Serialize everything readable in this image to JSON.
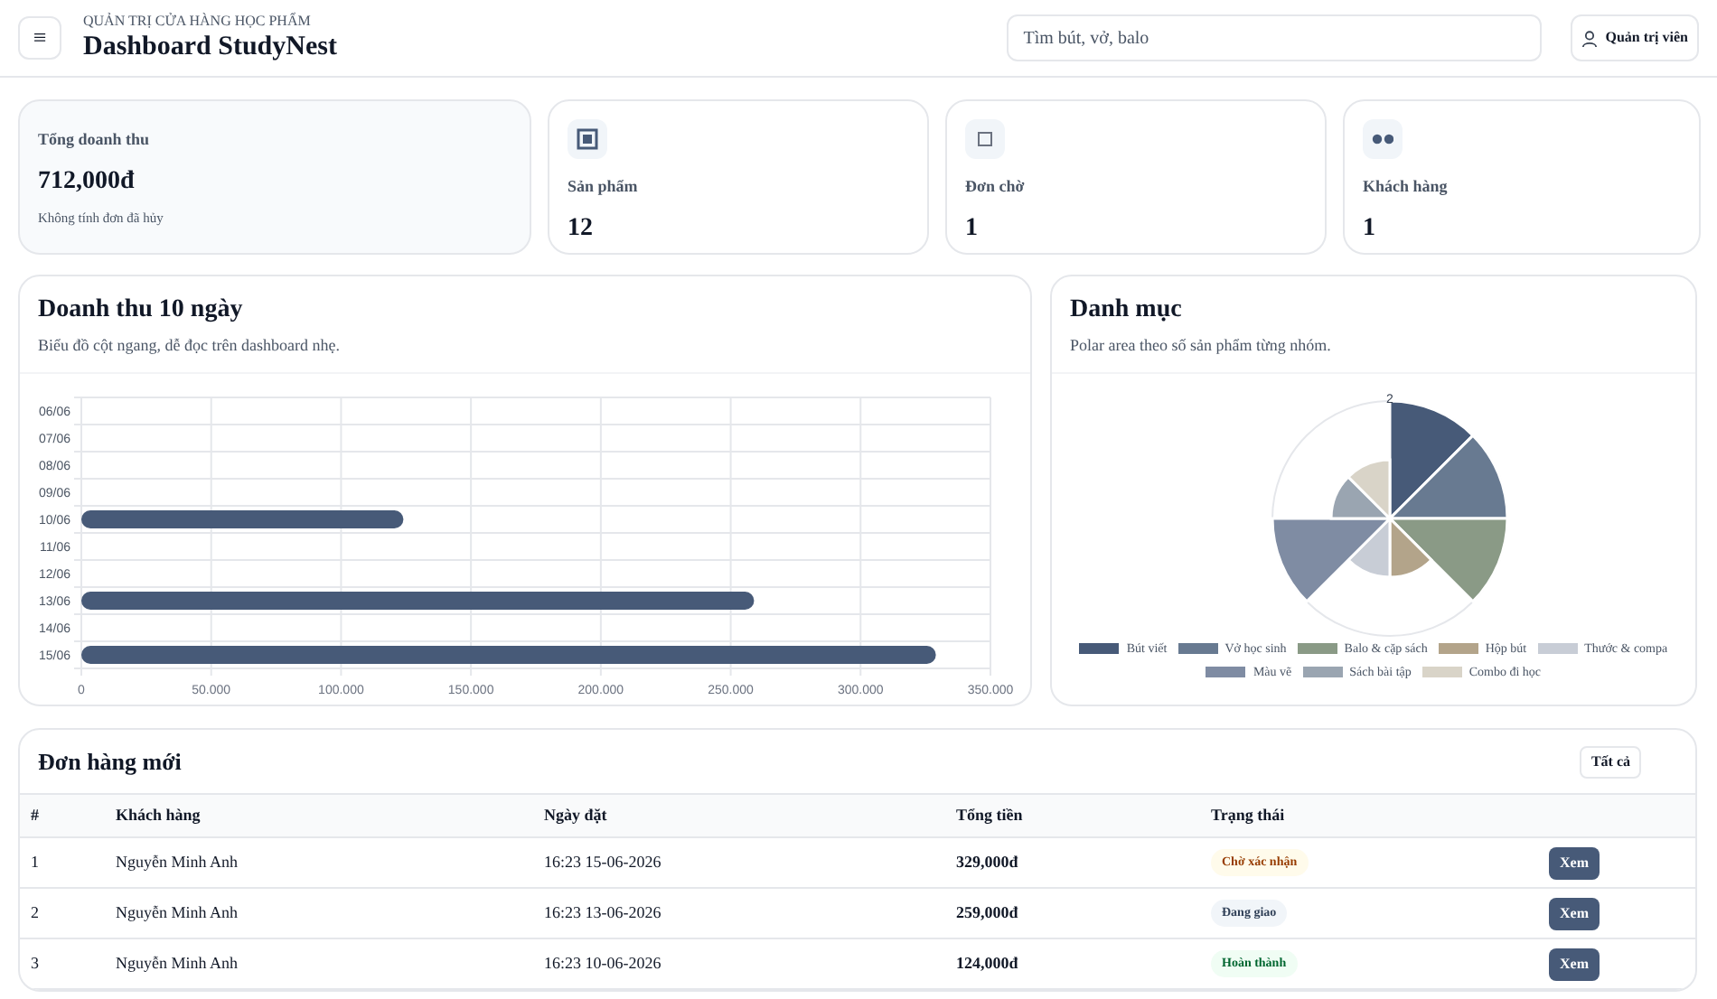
{
  "header": {
    "menu_icon": "≡",
    "subtitle": "QUẢN TRỊ CỬA HÀNG HỌC PHẨM",
    "title": "Dashboard StudyNest",
    "search": {
      "placeholder": "Tìm bút, vở, balo"
    },
    "user_button": "Quản trị viên"
  },
  "stats": [
    {
      "kind": "highlight",
      "label": "Tổng doanh thu",
      "value": "712,000đ",
      "note": "Không tính đơn đã hủy"
    },
    {
      "kind": "box",
      "label": "Sản phẩm",
      "value": "12"
    },
    {
      "kind": "box",
      "label": "Đơn chờ",
      "value": "1"
    },
    {
      "kind": "box",
      "label": "Khách hàng",
      "value": "1"
    }
  ],
  "revenue": {
    "title": "Doanh thu 10 ngày",
    "subtitle": "Biểu đồ cột ngang, dễ đọc trên dashboard nhẹ.",
    "chart_data": {
      "type": "bar",
      "orientation": "horizontal",
      "grid": true,
      "categories": [
        "06/06",
        "07/06",
        "08/06",
        "09/06",
        "10/06",
        "11/06",
        "12/06",
        "13/06",
        "14/06",
        "15/06"
      ],
      "series": [
        {
          "color": "#475a78",
          "values": [
            0,
            0,
            0,
            0,
            124000,
            0,
            0,
            259000,
            0,
            329000
          ]
        }
      ],
      "xlim": [
        0,
        350000
      ],
      "xticks": [
        {
          "value": 0,
          "label": "0"
        },
        {
          "value": 50000,
          "label": "50.000"
        },
        {
          "value": 100000,
          "label": "100.000"
        },
        {
          "value": 150000,
          "label": "150.000"
        },
        {
          "value": 200000,
          "label": "200.000"
        },
        {
          "value": 250000,
          "label": "250.000"
        },
        {
          "value": 300000,
          "label": "300.000"
        },
        {
          "value": 350000,
          "label": "350.000"
        }
      ]
    }
  },
  "categories": {
    "title": "Danh mục",
    "subtitle": "Polar area theo số sản phẩm từng nhóm.",
    "scale_label": "2",
    "items": [
      {
        "label": "Bút viết",
        "color": "#475a78"
      },
      {
        "label": "Vở học sinh",
        "color": "#687a91"
      },
      {
        "label": "Balo & cặp sách",
        "color": "#8a9a86"
      },
      {
        "label": "Hộp bút",
        "color": "#b3a48a"
      },
      {
        "label": "Thước & compa",
        "color": "#c8cdd6"
      },
      {
        "label": "Màu vẽ",
        "color": "#7f8ca3"
      },
      {
        "label": "Sách bài tập",
        "color": "#9aa5b1"
      },
      {
        "label": "Combo đi học",
        "color": "#d9d4c8"
      }
    ]
  },
  "orders": {
    "title": "Đơn hàng mới",
    "all_button": "Tất cả",
    "columns": [
      "#",
      "Khách hàng",
      "Ngày đặt",
      "Tổng tiền",
      "Trạng thái"
    ],
    "rows": [
      {
        "no": "1",
        "customer": "Nguyễn Minh Anh",
        "date": "16:23 15-06-2026",
        "total": "329,000đ",
        "status": "Chờ xác nhận",
        "kind": "pending",
        "action": "Xem"
      },
      {
        "no": "2",
        "customer": "Nguyễn Minh Anh",
        "date": "16:23 13-06-2026",
        "total": "259,000đ",
        "status": "Đang giao",
        "kind": "shipping",
        "action": "Xem"
      },
      {
        "no": "3",
        "customer": "Nguyễn Minh Anh",
        "date": "16:23 10-06-2026",
        "total": "124,000đ",
        "status": "Hoàn thành",
        "kind": "done",
        "action": "Xem"
      }
    ]
  }
}
